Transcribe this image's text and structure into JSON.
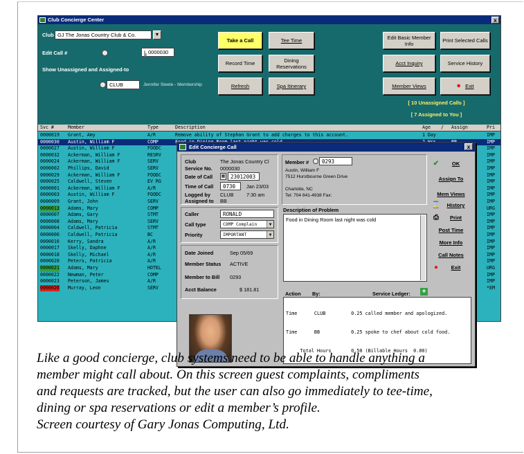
{
  "window": {
    "title": "Club Concierge Center",
    "close_glyph": "x"
  },
  "top": {
    "club_label": "Club",
    "club_value": "GJ The Jonas Country Club & Co.",
    "edit_call_label": "Edit Call #",
    "edit_call_btn": "L",
    "edit_call_value": "0000030",
    "show_label": "Show Unassigned and Assigned-to",
    "assigned_value": "CLUB",
    "assigned_name": "Jennifer Steele - Membership",
    "unassigned": "[ 10 Unassigned Calls ]",
    "assigned": "[ 7 Assigned to You ]"
  },
  "buttons": {
    "take_call": "Take a Call",
    "tee_time": "Tee Time",
    "record_time": "Record Time",
    "dining": "Dining Reservations",
    "refresh": "Refresh",
    "spa": "Spa Itinerary",
    "edit_member": "Edit Basic Member Info",
    "print_selected": "Print Selected Calls",
    "acct_inquiry": "Acct Inquiry",
    "service_history": "Service History",
    "member_views": "Member Views",
    "exit": "Exit"
  },
  "grid": {
    "headers": [
      "Svc #",
      "Member",
      "Type",
      "Description",
      "Age",
      "/",
      "Assign",
      "Pri"
    ],
    "rows": [
      {
        "svc": "0000019",
        "member": "Grant, Amy",
        "type": "A/R",
        "desc": "Remove ability of Stephan Grant to add charges to this account.",
        "age": "1 Day",
        "assign": "",
        "pri": "IMP",
        "hl": "",
        "sel": false
      },
      {
        "svc": "0000030",
        "member": "Austin, William F",
        "type": "COMP",
        "desc": "Food in Dining Room last night was cold",
        "age": "2 Hrs",
        "assign": "BB",
        "pri": "IMP",
        "hl": "",
        "sel": true
      },
      {
        "svc": "0000027",
        "member": "Austin, William F",
        "type": "FOODC",
        "desc": "",
        "age": "",
        "assign": "",
        "pri": "IMP",
        "hl": "",
        "sel": false
      },
      {
        "svc": "0000032",
        "member": "Ackerman, William F",
        "type": "RESRV",
        "desc": "",
        "age": "",
        "assign": "",
        "pri": "IMP",
        "hl": "",
        "sel": false
      },
      {
        "svc": "0000024",
        "member": "Ackerman, William F",
        "type": "SERV",
        "desc": "",
        "age": "",
        "assign": "",
        "pri": "IMP",
        "hl": "",
        "sel": false
      },
      {
        "svc": "0000002",
        "member": "Phillips, David",
        "type": "SERV",
        "desc": "",
        "age": "",
        "assign": "",
        "pri": "IMP",
        "hl": "",
        "sel": false
      },
      {
        "svc": "0000029",
        "member": "Ackerman, William F",
        "type": "FOODC",
        "desc": "",
        "age": "",
        "assign": "",
        "pri": "IMP",
        "hl": "",
        "sel": false
      },
      {
        "svc": "0000025",
        "member": "Caldwell, Steven",
        "type": "EV RG",
        "desc": "",
        "age": "",
        "assign": "",
        "pri": "IMP",
        "hl": "",
        "sel": false
      },
      {
        "svc": "0000001",
        "member": "Ackerman, William F",
        "type": "A/R",
        "desc": "",
        "age": "",
        "assign": "",
        "pri": "IMP",
        "hl": "",
        "sel": false
      },
      {
        "svc": "0000003",
        "member": "Austin, William F",
        "type": "FOODC",
        "desc": "",
        "age": "",
        "assign": "",
        "pri": "IMP",
        "hl": "",
        "sel": false
      },
      {
        "svc": "0000009",
        "member": "Grant, John",
        "type": "SERV",
        "desc": "",
        "age": "",
        "assign": "",
        "pri": "IMP",
        "hl": "",
        "sel": false
      },
      {
        "svc": "0000013",
        "member": "Adams, Mary",
        "type": "COMP",
        "desc": "",
        "age": "",
        "assign": "",
        "pri": "URG",
        "hl": "green",
        "sel": false
      },
      {
        "svc": "0000007",
        "member": "Adams, Gary",
        "type": "STMT",
        "desc": "",
        "age": "",
        "assign": "",
        "pri": "IMP",
        "hl": "",
        "sel": false
      },
      {
        "svc": "0000008",
        "member": "Adams, Mary",
        "type": "SERV",
        "desc": "",
        "age": "",
        "assign": "",
        "pri": "IMP",
        "hl": "",
        "sel": false
      },
      {
        "svc": "0000004",
        "member": "Caldwell, Patricia",
        "type": "STMT",
        "desc": "",
        "age": "",
        "assign": "",
        "pri": "IMP",
        "hl": "",
        "sel": false
      },
      {
        "svc": "0000006",
        "member": "Caldwell, Patricia",
        "type": "BC",
        "desc": "",
        "age": "",
        "assign": "",
        "pri": "IMP",
        "hl": "",
        "sel": false
      },
      {
        "svc": "0000016",
        "member": "Kerry, Sandra",
        "type": "A/R",
        "desc": "",
        "age": "",
        "assign": "",
        "pri": "IMP",
        "hl": "",
        "sel": false
      },
      {
        "svc": "0000017",
        "member": "Skelly, Daphne",
        "type": "A/R",
        "desc": "",
        "age": "",
        "assign": "",
        "pri": "IMP",
        "hl": "",
        "sel": false
      },
      {
        "svc": "0000018",
        "member": "Skelly, Michael",
        "type": "A/R",
        "desc": "",
        "age": "",
        "assign": "",
        "pri": "IMP",
        "hl": "",
        "sel": false
      },
      {
        "svc": "0000020",
        "member": "Peters, Patricia",
        "type": "A/R",
        "desc": "",
        "age": "",
        "assign": "",
        "pri": "IMP",
        "hl": "",
        "sel": false
      },
      {
        "svc": "0000021",
        "member": "Adams, Mary",
        "type": "HOTEL",
        "desc": "",
        "age": "",
        "assign": "",
        "pri": "URG",
        "hl": "green",
        "sel": false
      },
      {
        "svc": "0000022",
        "member": "Newman, Peter",
        "type": "COMP",
        "desc": "",
        "age": "",
        "assign": "",
        "pri": "IMP",
        "hl": "",
        "sel": false
      },
      {
        "svc": "0000023",
        "member": "Peterson, James",
        "type": "A/R",
        "desc": "",
        "age": "",
        "assign": "",
        "pri": "IMP",
        "hl": "",
        "sel": false
      },
      {
        "svc": "0000026",
        "member": "Murray, Leon",
        "type": "SERV",
        "desc": "",
        "age": "",
        "assign": "",
        "pri": "*EM",
        "hl": "red",
        "sel": false
      }
    ]
  },
  "dialog": {
    "title": "Edit Concierge Call",
    "club_label": "Club",
    "club_value": "The Jonas Country Cl",
    "service_label": "Service No.",
    "service_value": "0000030",
    "date_label": "Date of Call",
    "date_value": "23012003",
    "time_label": "Time of Call",
    "time_value": "0730",
    "time_display": "Jan 23/03",
    "logged_label": "Logged by",
    "logged_value": "CLUB",
    "logged_time": "7:30 am",
    "assigned_label": "Assigned to",
    "assigned_value": "BB",
    "member_label": "Member #",
    "member_value": "0293",
    "member_name": "Austin, William F",
    "member_addr": "7512 Hurstbourne Green Drive",
    "member_city": "Charlotte, NC",
    "member_tel": "Tel: 704 841-4938   Fax:",
    "caller_label": "Caller",
    "caller_value": "RONALD",
    "calltype_label": "Call type",
    "calltype_value": "COMP  Complain",
    "priority_label": "Priority",
    "priority_value": "IMPORTANT",
    "joined_label": "Date Joined",
    "joined_value": "Sep 05/69",
    "status_label": "Member Status",
    "status_value": "ACTIVE",
    "bill_label": "Member to Bill",
    "bill_value": "0293",
    "balance_label": "Acct Balance",
    "balance_value": "$ 181.81",
    "desc_label": "Description of Problem",
    "desc_value": "Food in Dining Room last night was cold",
    "action_label": "Action",
    "by_label": "By:",
    "ledger_label": "Service Ledger:",
    "ledger": [
      "Time      CLUB         0.25 called member and apologized.",
      "Time      BB           0.25 spoke to chef about cold food.",
      "     Total Hours       0.50 (Billable Hours  0.00)"
    ],
    "side_buttons": [
      "OK",
      "Assign To",
      "Mem Views",
      "History",
      "Print",
      "Post Time",
      "More Info",
      "Call Notes",
      "Exit"
    ]
  },
  "caption": [
    "Like a good concierge, club systems need to be able to handle anything a",
    "member might call about.  On this screen guest complaints, compliments",
    "and requests are tracked, but the user can also go immediately to tee-time,",
    "dining or spa reservations or edit a member’s profile.",
    "Screen courtesy of Gary Jonas Computing, Ltd."
  ]
}
